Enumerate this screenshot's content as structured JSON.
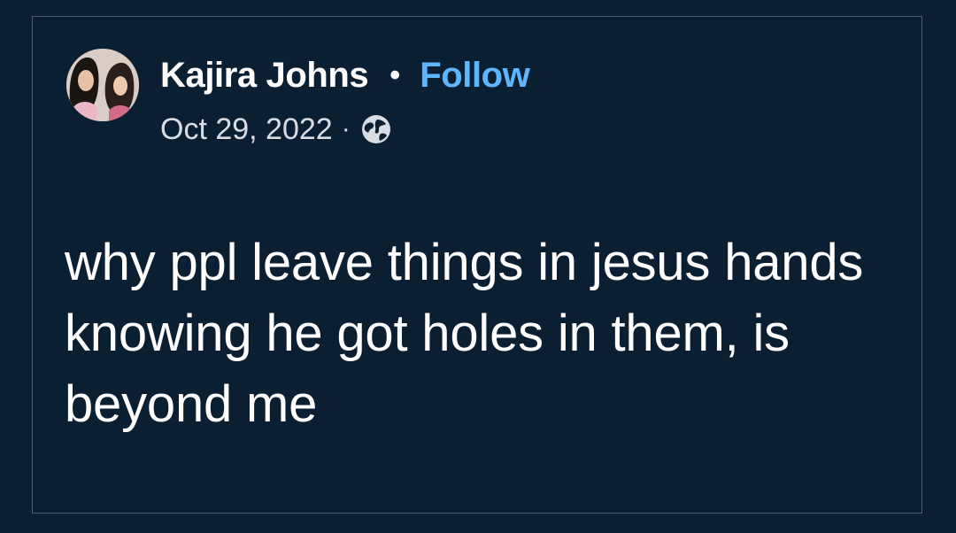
{
  "post": {
    "author_name": "Kajira Johns",
    "separator_dot": "•",
    "follow_label": "Follow",
    "date": "Oct 29, 2022",
    "meta_separator": "·",
    "privacy_icon": "globe-icon",
    "text": "why ppl leave things in jesus hands knowing he got holes in them, is beyond me"
  },
  "colors": {
    "background": "#0b1f33",
    "border": "#4b6071",
    "text": "#ffffff",
    "follow": "#5fb6ff",
    "meta": "#d8dde3"
  }
}
